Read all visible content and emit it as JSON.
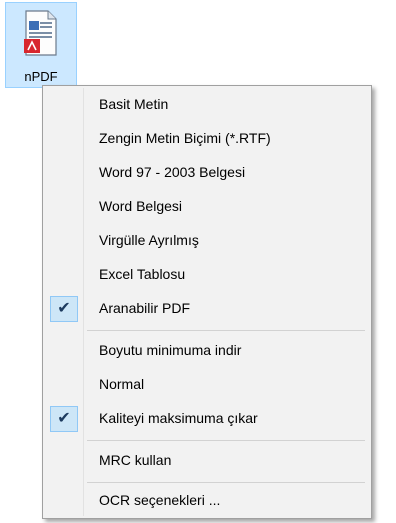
{
  "desktop_icon": {
    "label": "nPDF",
    "icon": "pdf-document-icon"
  },
  "menu": {
    "items": [
      {
        "label": "Basit Metin",
        "checked": false
      },
      {
        "label": "Zengin Metin Biçimi (*.RTF)",
        "checked": false
      },
      {
        "label": "Word 97 - 2003 Belgesi",
        "checked": false
      },
      {
        "label": "Word Belgesi",
        "checked": false
      },
      {
        "label": "Virgülle Ayrılmış",
        "checked": false
      },
      {
        "label": "Excel Tablosu",
        "checked": false
      },
      {
        "label": "Aranabilir PDF",
        "checked": true
      },
      {
        "label": "Boyutu minimuma indir",
        "checked": false
      },
      {
        "label": "Normal",
        "checked": false
      },
      {
        "label": "Kaliteyi maksimuma çıkar",
        "checked": true
      },
      {
        "label": "MRC kullan",
        "checked": false
      },
      {
        "label": "OCR seçenekleri ...",
        "checked": false
      }
    ],
    "check_glyph": "✔",
    "colors": {
      "check_bg": "#cde6f7",
      "check_border": "#90c8f6",
      "menu_bg": "#f2f2f2"
    }
  }
}
